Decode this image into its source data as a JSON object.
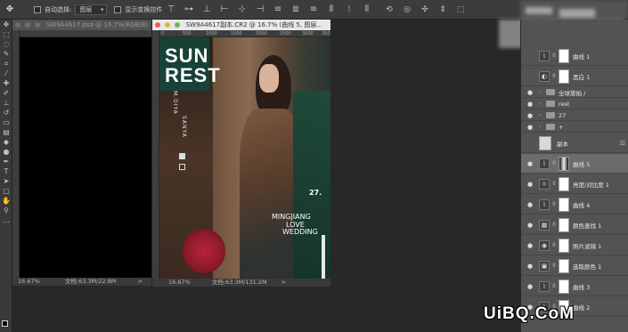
{
  "options_bar": {
    "auto_select_label": "自动选择:",
    "auto_select_value": "图层",
    "show_transform_label": "显示变换控件"
  },
  "doc1": {
    "title": "SW9A4617.psd @ 16.7%(RGB/8)",
    "zoom": "16.67%",
    "doc_info": "文档:63.3M/22.8M"
  },
  "doc2": {
    "title": "SW9A4617副本.CR2 @ 16.7% (曲线 5, 图层...",
    "zoom": "16.67%",
    "doc_info": "文档:63.3M/131.2M",
    "ruler_marks": [
      "0",
      "500",
      "1000",
      "1500",
      "2000",
      "2500",
      "3000",
      "3500"
    ]
  },
  "poster": {
    "title_line1": "SUN",
    "title_line2": "REST",
    "vertical_1": "M.DIYA",
    "vertical_2": "SANYA",
    "number": "27.",
    "sub_1": "MINGJIANG",
    "sub_2": "LOVE",
    "sub_3": "WEDDING"
  },
  "layers": [
    {
      "name": "曲线 1",
      "type": "adjustment",
      "icon": "curves-icon"
    },
    {
      "name": "黑白 1",
      "type": "adjustment",
      "icon": "black-white-icon"
    },
    {
      "name": "全球旅拍 /",
      "type": "group"
    },
    {
      "name": "rest",
      "type": "group"
    },
    {
      "name": "27",
      "type": "group"
    },
    {
      "name": "+",
      "type": "group"
    },
    {
      "name": "副本",
      "type": "smart"
    },
    {
      "name": "曲线 5",
      "type": "adjustment",
      "icon": "curves-icon",
      "selected": true
    },
    {
      "name": "亮度/对比度 1",
      "type": "adjustment",
      "icon": "brightness-icon"
    },
    {
      "name": "曲线 4",
      "type": "adjustment",
      "icon": "curves-icon"
    },
    {
      "name": "颜色查找 1",
      "type": "adjustment",
      "icon": "color-lookup-icon"
    },
    {
      "name": "照片滤镜 1",
      "type": "adjustment",
      "icon": "photo-filter-icon"
    },
    {
      "name": "选取颜色 1",
      "type": "adjustment",
      "icon": "selective-color-icon"
    },
    {
      "name": "曲线 3",
      "type": "adjustment",
      "icon": "curves-icon"
    },
    {
      "name": "曲线 2",
      "type": "adjustment",
      "icon": "curves-icon"
    }
  ],
  "watermark": "UiBQ.CoM"
}
